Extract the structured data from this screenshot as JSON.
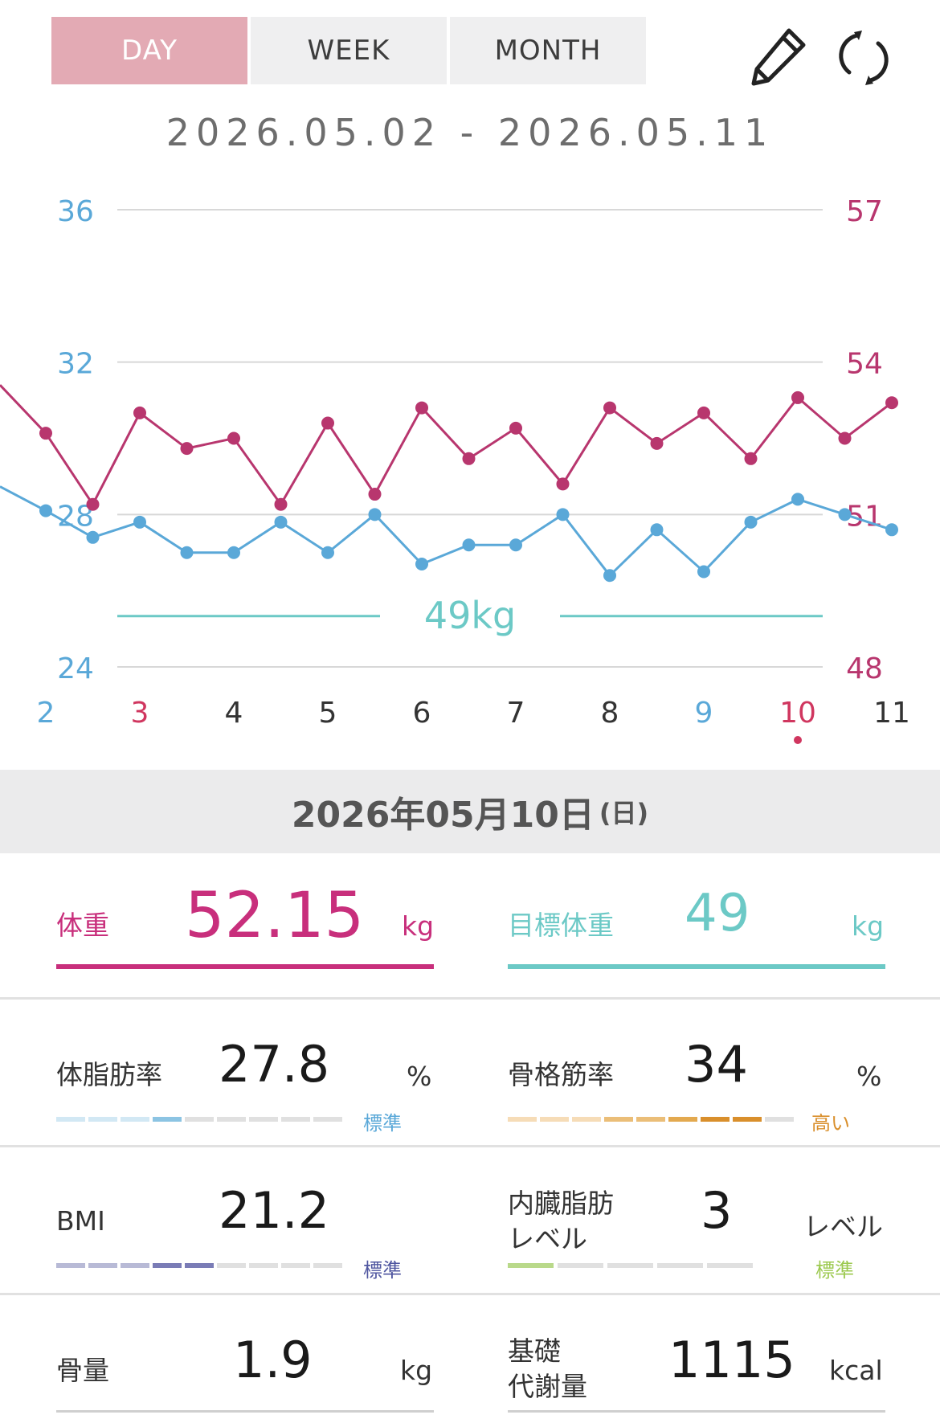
{
  "tabs": [
    {
      "label": "DAY",
      "active": true
    },
    {
      "label": "WEEK",
      "active": false
    },
    {
      "label": "MONTH",
      "active": false
    }
  ],
  "toolbar": {
    "edit_icon": "pencil-icon",
    "refresh_icon": "refresh-icon"
  },
  "date_range": "2026.05.02 - 2026.05.11",
  "chart_data": {
    "type": "line",
    "x": [
      1,
      1.5,
      2,
      2.5,
      3,
      3.5,
      4,
      4.5,
      5,
      5.5,
      6,
      6.5,
      7,
      7.5,
      8,
      8.5,
      9,
      9.5,
      10,
      10.5
    ],
    "x_tick_labels": [
      "2",
      "3",
      "4",
      "5",
      "6",
      "7",
      "8",
      "9",
      "10",
      "11"
    ],
    "x_tick_colors": [
      "#5aa8d8",
      "#d0365f",
      "#333333",
      "#333333",
      "#333333",
      "#333333",
      "#333333",
      "#5aa8d8",
      "#d0365f",
      "#333333"
    ],
    "selected_tick": "10",
    "series": [
      {
        "axis": "right",
        "color": "#b8366e",
        "values": [
          52.6,
          51.2,
          53.0,
          52.3,
          52.5,
          51.2,
          52.8,
          51.4,
          53.1,
          52.1,
          52.7,
          51.6,
          53.1,
          52.4,
          53.0,
          52.1,
          53.3,
          52.5,
          53.2
        ]
      },
      {
        "axis": "left",
        "color": "#5aa8d8",
        "values": [
          28.1,
          27.4,
          27.8,
          27.0,
          27.0,
          27.8,
          27.0,
          28.0,
          26.7,
          27.2,
          27.2,
          28.0,
          26.4,
          27.6,
          26.5,
          27.8,
          28.4,
          28.0,
          27.6
        ]
      }
    ],
    "y_left": {
      "ticks": [
        36,
        32,
        28,
        24
      ],
      "range": [
        24,
        36
      ],
      "color": "#5aa8d8"
    },
    "y_right": {
      "ticks": [
        57,
        54,
        51,
        48
      ],
      "range": [
        48,
        57
      ],
      "color": "#b8366e"
    },
    "target_line": {
      "value": 49,
      "label": "49kg",
      "axis": "right",
      "color": "#6cc9c6"
    },
    "grid": true
  },
  "selected_date": {
    "main": "2026年05月10日",
    "weekday": "(日)"
  },
  "stats": {
    "weight": {
      "label": "体重",
      "value": "52.15",
      "unit": "kg",
      "color": "#c82f7c"
    },
    "target_weight": {
      "label": "目標体重",
      "value": "49",
      "unit": "kg",
      "color": "#6cc9c6"
    },
    "body_fat": {
      "label": "体脂肪率",
      "value": "27.8",
      "unit": "%",
      "level": "標準",
      "level_color": "#5aa8d8"
    },
    "skeletal_muscle": {
      "label": "骨格筋率",
      "value": "34",
      "unit": "%",
      "level": "高い",
      "level_color": "#d98f2c"
    },
    "bmi": {
      "label": "BMI",
      "value": "21.2",
      "level": "標準",
      "level_color": "#4f56a0"
    },
    "visceral_fat": {
      "label_line1": "内臓脂肪",
      "label_line2": "レベル",
      "value": "3",
      "unit": "レベル",
      "level": "標準",
      "level_color": "#9cc94f"
    },
    "bone_mass": {
      "label": "骨量",
      "value": "1.9",
      "unit": "kg"
    },
    "bmr": {
      "label_line1": "基礎",
      "label_line2": "代謝量",
      "value": "1115",
      "unit": "kcal"
    }
  }
}
